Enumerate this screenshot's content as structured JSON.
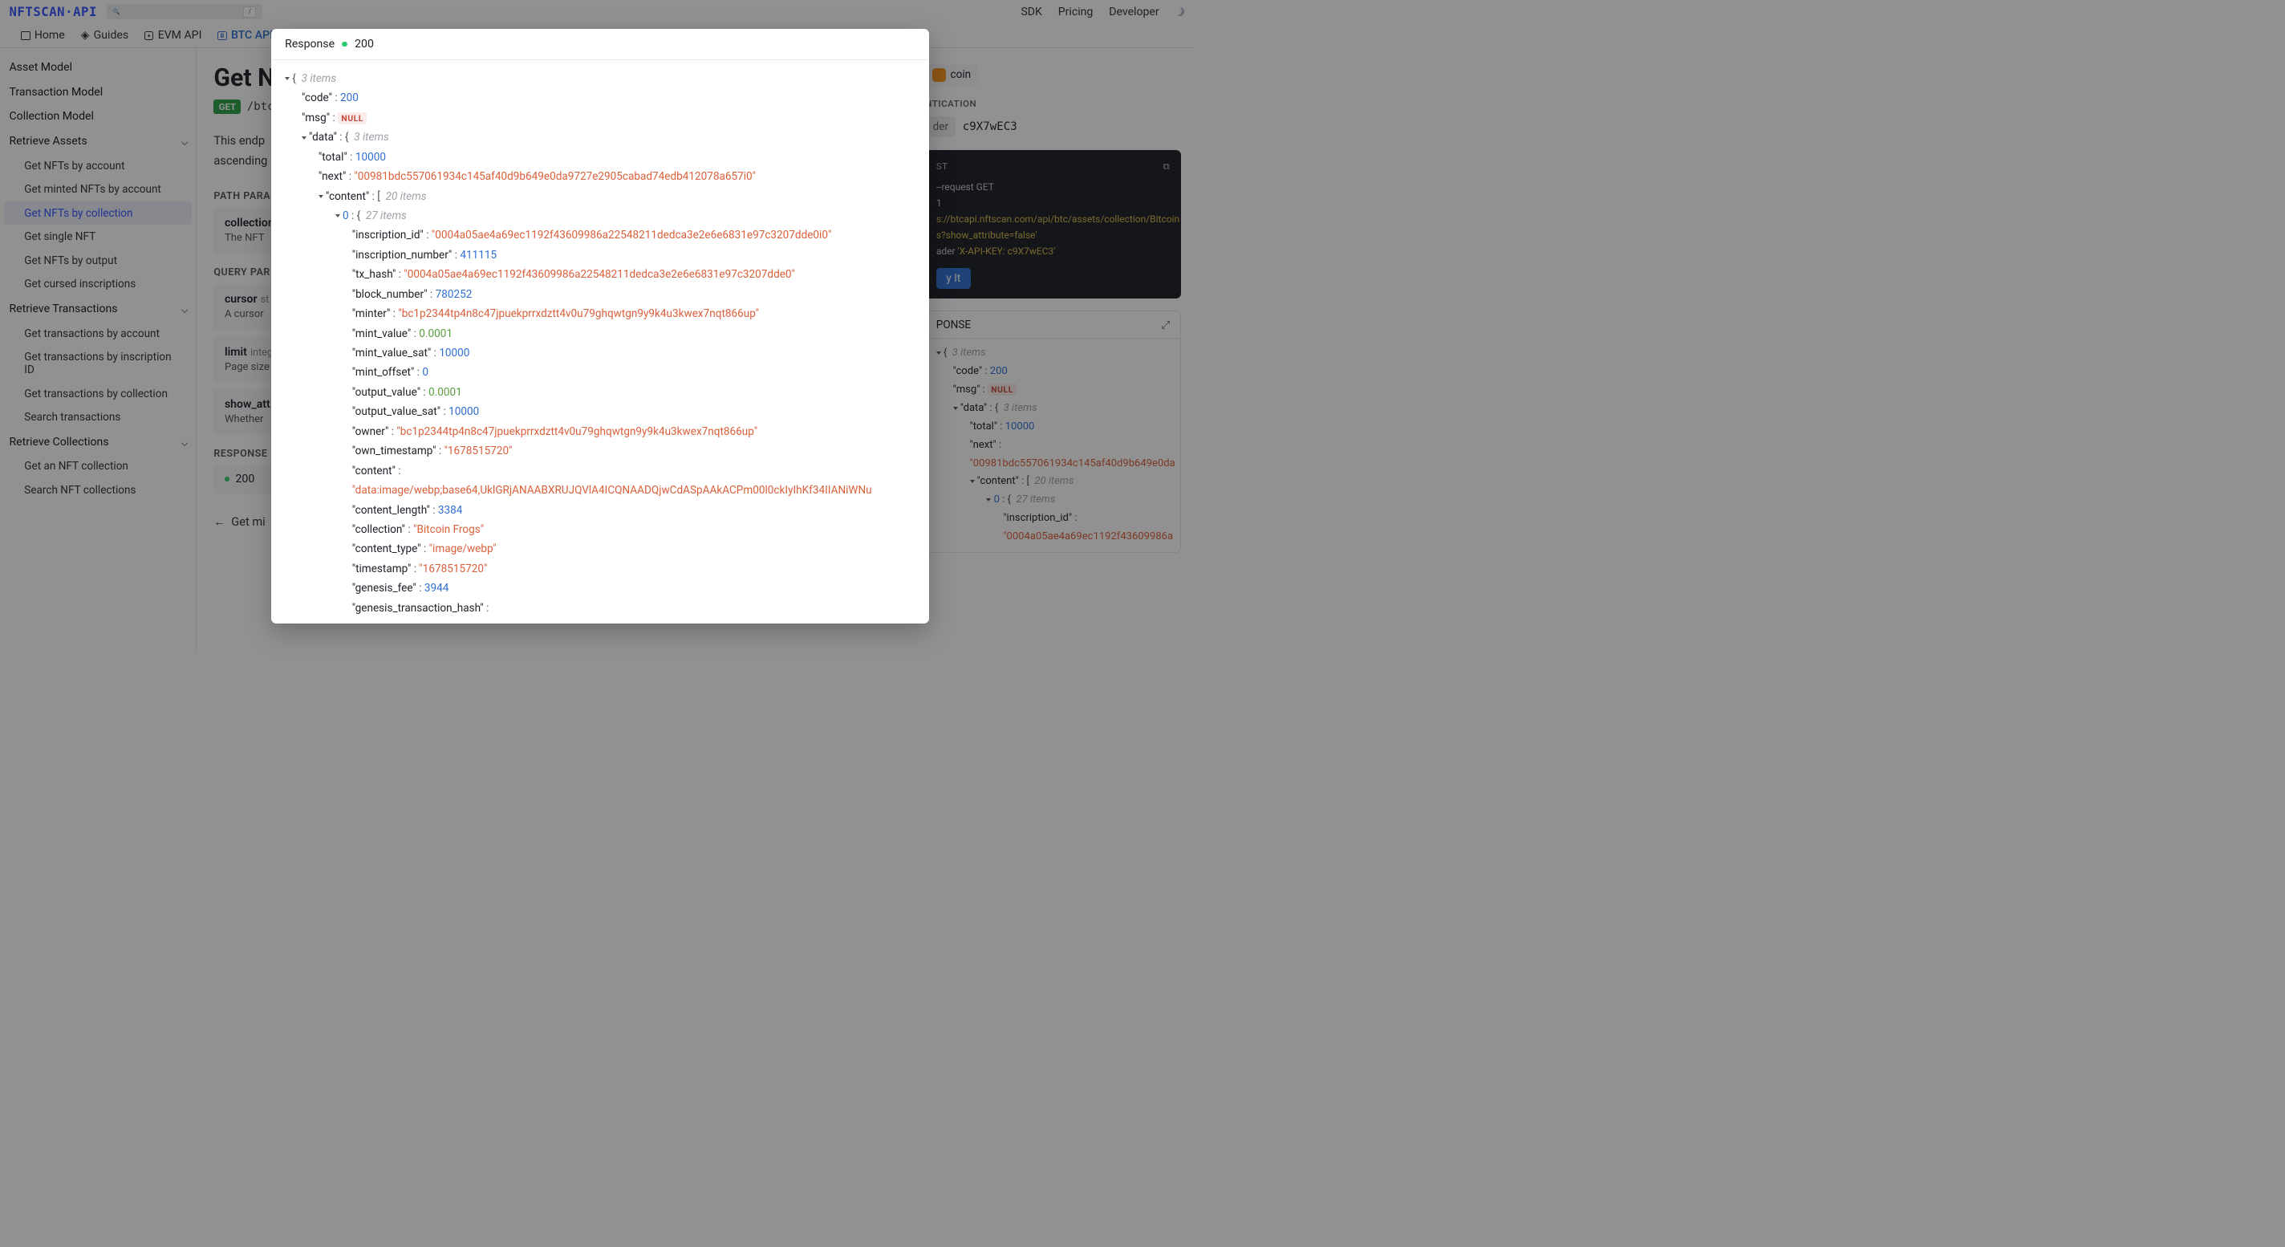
{
  "header": {
    "logo": "NFTSCAN·API",
    "search_placeholder": "",
    "search_shortcut": "/",
    "links": [
      "SDK",
      "Pricing",
      "Developer"
    ]
  },
  "subnav": {
    "home": "Home",
    "guides": "Guides",
    "evm": "EVM API",
    "btc": "BTC API"
  },
  "sidebar": {
    "sections": [
      {
        "label": "Asset Model"
      },
      {
        "label": "Transaction Model"
      },
      {
        "label": "Collection Model"
      }
    ],
    "groups": [
      {
        "label": "Retrieve Assets",
        "items": [
          "Get NFTs by account",
          "Get minted NFTs by account",
          "Get NFTs by collection",
          "Get single NFT",
          "Get NFTs by output",
          "Get cursed inscriptions"
        ],
        "active_index": 2
      },
      {
        "label": "Retrieve Transactions",
        "items": [
          "Get transactions by account",
          "Get transactions by inscription ID",
          "Get transactions by collection",
          "Search transactions"
        ]
      },
      {
        "label": "Retrieve Collections",
        "items": [
          "Get an NFT collection",
          "Search NFT collections"
        ]
      }
    ]
  },
  "page": {
    "title": "Get N",
    "method": "GET",
    "path": "/btc/",
    "description_line1": "This endp",
    "description_line2": "ascending",
    "path_params_label": "PATH PARA",
    "query_params_label": "QUERY PAR",
    "responses_label": "RESPONSE",
    "params": {
      "collection": {
        "name": "collection",
        "desc": "The NFT"
      },
      "cursor": {
        "name": "cursor",
        "type": "st",
        "desc": "A cursor"
      },
      "limit": {
        "name": "limit",
        "type": "integ",
        "desc": "Page size"
      },
      "show_attribute": {
        "name": "show_att",
        "desc": "Whether"
      }
    },
    "response_code": "200",
    "back_link": "Get mi"
  },
  "right": {
    "chain_label": "coin",
    "auth_label": "NTICATION",
    "auth_header": "der",
    "auth_value": "c9X7wEC3",
    "request_label": "ST",
    "copy_title": "copy",
    "response_label": "PONSE",
    "curl": {
      "l1": "--request GET",
      "l2": "1",
      "l3": "s://btcapi.nftscan.com/api/btc/assets/collection/Bitcoin",
      "l4": "s?show_attribute=false'",
      "l5": "ader 'X-API-KEY: c9X7wEC3'"
    },
    "try_it": "y It"
  },
  "modal": {
    "title": "Response",
    "status": "200"
  },
  "json": {
    "root_meta": "3 items",
    "code_key": "code",
    "code_val": "200",
    "msg_key": "msg",
    "msg_val": "NULL",
    "data_key": "data",
    "data_meta": "3 items",
    "total_key": "total",
    "total_val": "10000",
    "next_key": "next",
    "next_val": "00981bdc557061934c145af40d9b649e0da9727e2905cabad74edb412078a657i0",
    "content_key": "content",
    "content_meta": "20 items",
    "item_idx": "0",
    "item_meta": "27 items",
    "fields": {
      "inscription_id": {
        "k": "inscription_id",
        "v": "0004a05ae4a69ec1192f43609986a22548211dedca3e2e6e6831e97c3207dde0i0",
        "t": "str"
      },
      "inscription_number": {
        "k": "inscription_number",
        "v": "411115",
        "t": "num"
      },
      "tx_hash": {
        "k": "tx_hash",
        "v": "0004a05ae4a69ec1192f43609986a22548211dedca3e2e6e6831e97c3207dde0",
        "t": "str"
      },
      "block_number": {
        "k": "block_number",
        "v": "780252",
        "t": "num"
      },
      "minter": {
        "k": "minter",
        "v": "bc1p2344tp4n8c47jpuekprrxdztt4v0u79ghqwtgn9y9k4u3kwex7nqt866up",
        "t": "str"
      },
      "mint_value": {
        "k": "mint_value",
        "v": "0.0001",
        "t": "green"
      },
      "mint_value_sat": {
        "k": "mint_value_sat",
        "v": "10000",
        "t": "num"
      },
      "mint_offset": {
        "k": "mint_offset",
        "v": "0",
        "t": "num"
      },
      "output_value": {
        "k": "output_value",
        "v": "0.0001",
        "t": "green"
      },
      "output_value_sat": {
        "k": "output_value_sat",
        "v": "10000",
        "t": "num"
      },
      "owner": {
        "k": "owner",
        "v": "bc1p2344tp4n8c47jpuekprrxdztt4v0u79ghqwtgn9y9k4u3kwex7nqt866up",
        "t": "str"
      },
      "own_timestamp": {
        "k": "own_timestamp",
        "v": "1678515720",
        "t": "str"
      },
      "content": {
        "k": "content",
        "v": "data:image/webp;base64,UklGRjANAABXRUJQVlA4ICQNAADQjwCdASpAAkACPm00l0ckIyIhKf34IIANiWNu",
        "t": "str_break"
      },
      "content_length": {
        "k": "content_length",
        "v": "3384",
        "t": "num"
      },
      "collection": {
        "k": "collection",
        "v": "Bitcoin Frogs",
        "t": "str"
      },
      "content_type": {
        "k": "content_type",
        "v": "image/webp",
        "t": "str"
      },
      "timestamp": {
        "k": "timestamp",
        "v": "1678515720",
        "t": "str"
      },
      "genesis_fee": {
        "k": "genesis_fee",
        "v": "3944",
        "t": "num"
      },
      "genesis_transaction_hash": {
        "k": "genesis_transaction_hash",
        "v": "",
        "t": "partial"
      }
    }
  },
  "side_json": {
    "next_val": "00981bdc557061934c145af40d9b649e0da",
    "inscription_id_val": "0004a05ae4a69ec1192f43609986a"
  }
}
